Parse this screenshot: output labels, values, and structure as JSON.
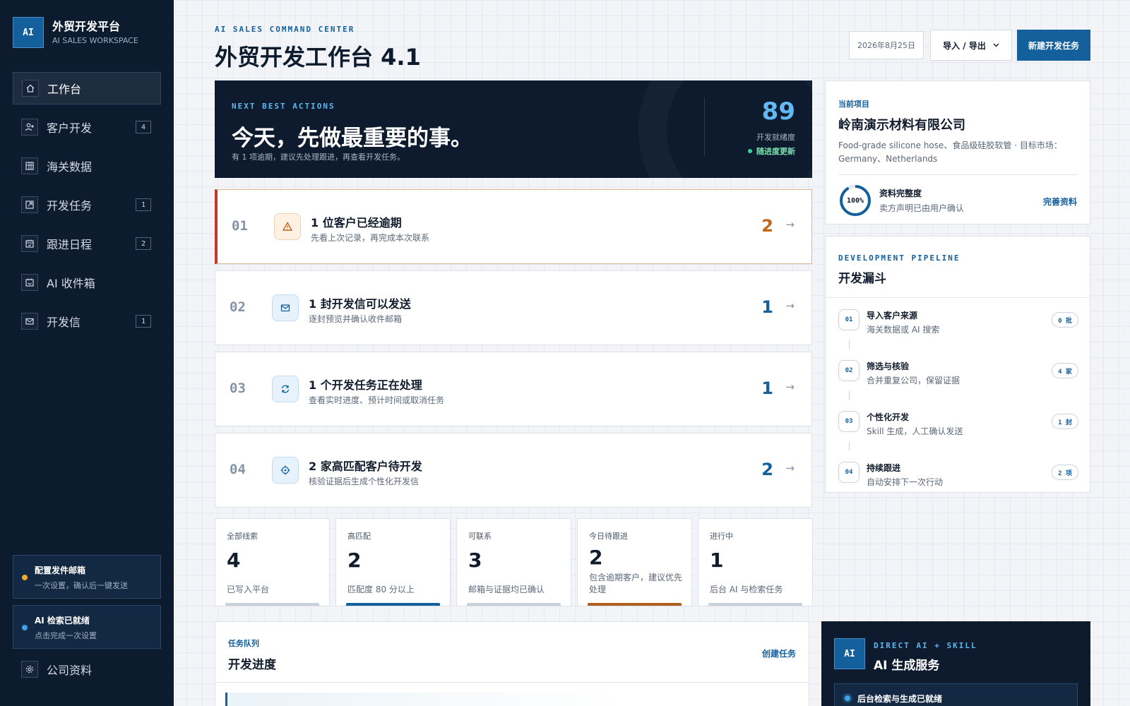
{
  "brand": {
    "logo": "AI",
    "title": "外贸开发平台",
    "subtitle": "AI SALES WORKSPACE"
  },
  "sidebar": {
    "items": [
      {
        "label": "工作台",
        "icon": "home-icon",
        "badge": ""
      },
      {
        "label": "客户开发",
        "icon": "user-plus-icon",
        "badge": "4"
      },
      {
        "label": "海关数据",
        "icon": "grid-table-icon",
        "badge": ""
      },
      {
        "label": "开发任务",
        "icon": "external-link-icon",
        "badge": "1"
      },
      {
        "label": "跟进日程",
        "icon": "calendar-icon",
        "badge": "2"
      },
      {
        "label": "AI 收件箱",
        "icon": "inbox-icon",
        "badge": ""
      },
      {
        "label": "开发信",
        "icon": "mail-icon",
        "badge": "1"
      }
    ],
    "setup_mail": {
      "title": "配置发件邮箱",
      "subtitle": "一次设置，确认后一键发送",
      "dot_color": "#f0a830"
    },
    "ai_ready": {
      "title": "AI 检索已就绪",
      "subtitle": "点击完成一次设置",
      "dot_color": "#3da4ea"
    },
    "settings": {
      "label": "公司资料",
      "icon": "gear-icon"
    }
  },
  "header": {
    "eyebrow": "AI SALES COMMAND CENTER",
    "title": "外贸开发工作台 4.1",
    "date": "2026年8月25日",
    "import_export": "导入 / 导出",
    "new_task": "新建开发任务"
  },
  "hero": {
    "eyebrow": "NEXT BEST ACTIONS",
    "title": "今天，先做最重要的事。",
    "subtitle": "有 1 项逾期，建议先处理跟进，再查看开发任务。",
    "score": "89",
    "score_label": "开发就绪度",
    "live": "随进度更新"
  },
  "actions": [
    {
      "num": "01",
      "icon": "warning-icon",
      "title": "1 位客户已经逾期",
      "subtitle": "先看上次记录，再完成本次联系",
      "count": "2"
    },
    {
      "num": "02",
      "icon": "mail-icon",
      "title": "1 封开发信可以发送",
      "subtitle": "逐封预览并确认收件邮箱",
      "count": "1"
    },
    {
      "num": "03",
      "icon": "refresh-icon",
      "title": "1 个开发任务正在处理",
      "subtitle": "查看实时进度、预计时间或取消任务",
      "count": "1"
    },
    {
      "num": "04",
      "icon": "target-icon",
      "title": "2 家高匹配客户待开发",
      "subtitle": "核验证据后生成个性化开发信",
      "count": "2"
    }
  ],
  "stats": [
    {
      "label": "全部线索",
      "value": "4",
      "desc": "已写入平台",
      "bar_color": "#c9d1db"
    },
    {
      "label": "高匹配",
      "value": "2",
      "desc": "匹配度 80 分以上",
      "bar_color": "#14609c"
    },
    {
      "label": "可联系",
      "value": "3",
      "desc": "邮箱与证据均已确认",
      "bar_color": "#c9d1db"
    },
    {
      "label": "今日待跟进",
      "value": "2",
      "desc": "包含逾期客户，建议优先处理",
      "bar_color": "#b0601c"
    },
    {
      "label": "进行中",
      "value": "1",
      "desc": "后台 AI 与检索任务",
      "bar_color": "#c9d1db"
    }
  ],
  "project": {
    "eyebrow": "当前项目",
    "name": "岭南演示材料有限公司",
    "desc": "Food-grade silicone hose、食品级硅胶软管 · 目标市场：Germany、Netherlands",
    "completeness": 1.0,
    "completeness_text": "100%",
    "completeness_title": "资料完整度",
    "completeness_sub": "卖方声明已由用户确认",
    "link": "完善资料"
  },
  "pipeline": {
    "eyebrow": "DEVELOPMENT PIPELINE",
    "title": "开发漏斗",
    "steps": [
      {
        "num": "01",
        "title": "导入客户来源",
        "subtitle": "海关数据或 AI 搜索",
        "badge": "0 批"
      },
      {
        "num": "02",
        "title": "筛选与核验",
        "subtitle": "合并重复公司，保留证据",
        "badge": "4 家"
      },
      {
        "num": "03",
        "title": "个性化开发",
        "subtitle": "Skill 生成，人工确认发送",
        "badge": "1 封"
      },
      {
        "num": "04",
        "title": "持续跟进",
        "subtitle": "自动安排下一次行动",
        "badge": "2 项"
      }
    ]
  },
  "queue": {
    "eyebrow": "任务队列",
    "title": "开发进度",
    "link": "创建任务"
  },
  "ai_service": {
    "logo": "AI",
    "eyebrow": "DIRECT AI + SKILL",
    "title": "AI 生成服务",
    "status": "后台检索与生成已就绪"
  },
  "colors": {
    "accent": "#14609c",
    "sidebar": "#0d1b2e",
    "warning": "#c0392b"
  }
}
